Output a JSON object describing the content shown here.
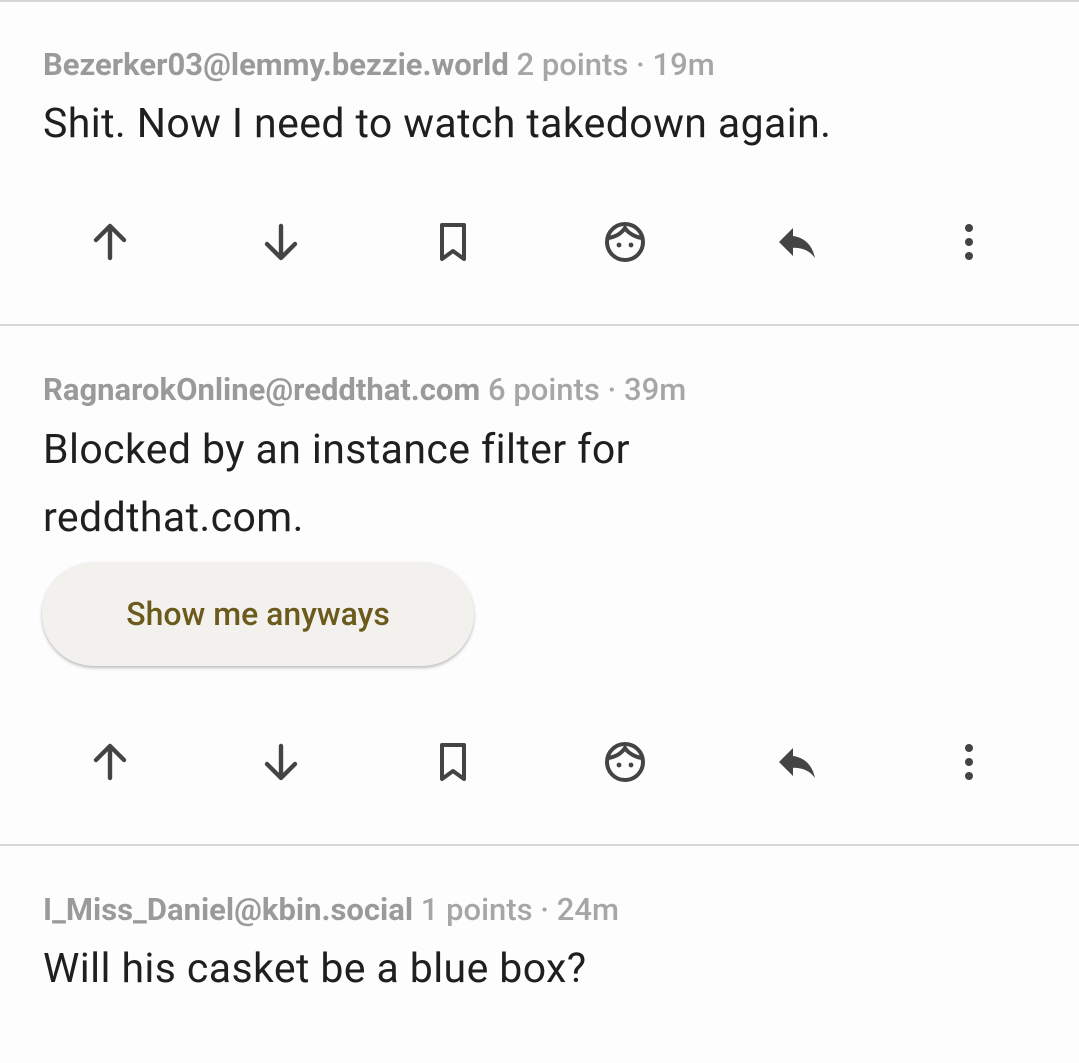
{
  "comments": [
    {
      "author": "Bezerker03@lemmy.bezzie.world",
      "points": "2 points",
      "sep": "·",
      "time": "19m",
      "text": "Shit. Now I need to watch takedown again."
    },
    {
      "author": "RagnarokOnline@reddthat.com",
      "points": "6 points",
      "sep": "·",
      "time": "39m",
      "text_line1": "Blocked by an instance filter for",
      "text_line2": "reddthat.com.",
      "show_button": "Show me anyways"
    },
    {
      "author": "I_Miss_Daniel@kbin.social",
      "points": "1 points",
      "sep": "·",
      "time": "24m",
      "text": "Will his casket be a blue box?"
    }
  ],
  "actions": [
    "upvote-icon",
    "downvote-icon",
    "bookmark-icon",
    "user-icon",
    "reply-icon",
    "more-vert-icon"
  ]
}
